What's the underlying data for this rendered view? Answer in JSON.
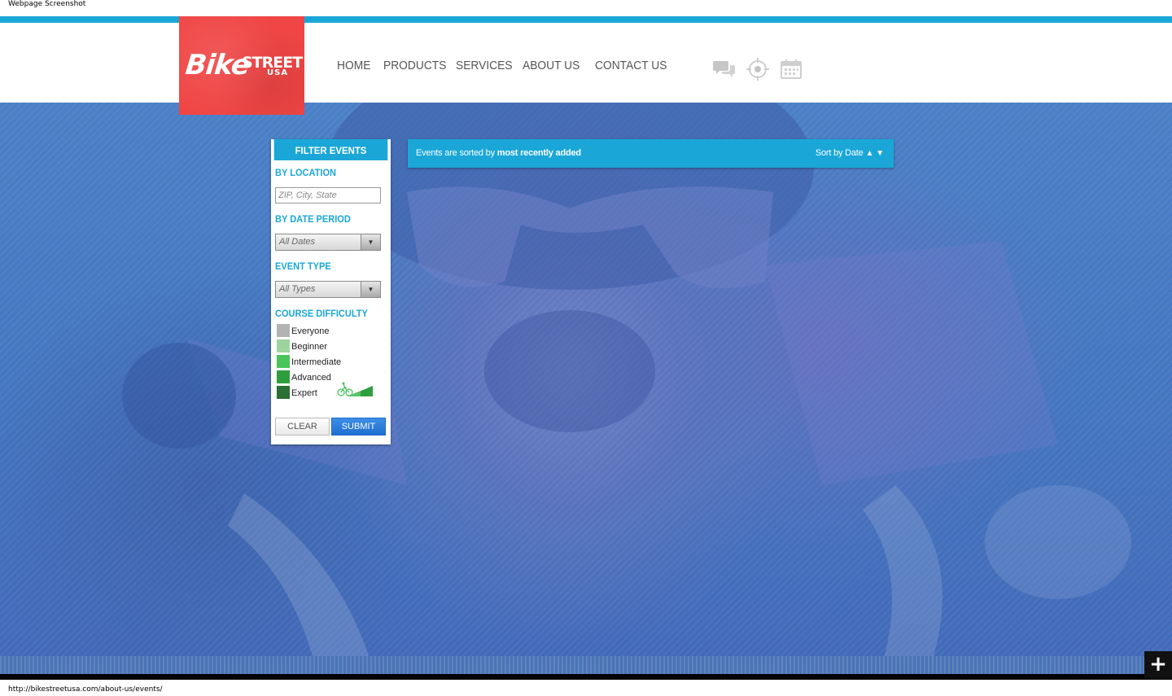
{
  "screenshot_label": "Webpage Screenshot",
  "brand": {
    "bike": "Bike",
    "street": "STREET",
    "usa": "USA",
    "logo_color": "#f04545",
    "accent": "#1aa7d8"
  },
  "nav": {
    "items": [
      {
        "label": "HOME"
      },
      {
        "label": "PRODUCTS"
      },
      {
        "label": "SERVICES"
      },
      {
        "label": "ABOUT US"
      },
      {
        "label": "CONTACT US"
      }
    ]
  },
  "header_icons": [
    "chat-bubbles-icon",
    "target-icon",
    "calendar-icon"
  ],
  "filter": {
    "title": "FILTER EVENTS",
    "location_title": "BY LOCATION",
    "location_placeholder": "ZIP, City, State",
    "date_title": "BY DATE PERIOD",
    "date_value": "All Dates",
    "type_title": "EVENT TYPE",
    "type_value": "All Types",
    "difficulty_title": "COURSE DIFFICULTY",
    "difficulty": [
      {
        "label": "Everyone",
        "color": "#b3b3b3"
      },
      {
        "label": "Beginner",
        "color": "#9ed39e"
      },
      {
        "label": "Intermediate",
        "color": "#49c45a"
      },
      {
        "label": "Advanced",
        "color": "#2f9e3f"
      },
      {
        "label": "Expert",
        "color": "#2a6f33"
      }
    ],
    "clear_label": "CLEAR",
    "submit_label": "SUBMIT"
  },
  "sortbar": {
    "prefix": "Events are sorted by",
    "sorted_by": "most recently added",
    "sort_label": "Sort by Date",
    "up_arrow": "▲",
    "down_arrow": "▼"
  },
  "floating_button": "+",
  "status_url": "http://bikestreetusa.com/about-us/events/"
}
